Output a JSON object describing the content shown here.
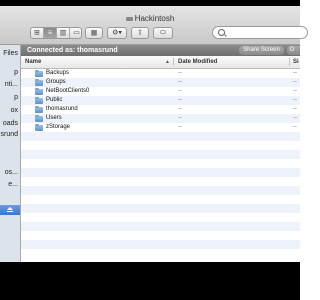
{
  "window": {
    "title": "Hackintosh"
  },
  "toolbar": {
    "view_buttons": [
      "icon-view",
      "list-view",
      "column-view",
      "coverflow-view"
    ],
    "selected_view": "list-view",
    "search": {
      "placeholder": "",
      "value": ""
    }
  },
  "sidebar": {
    "items": [
      {
        "label": "Files"
      },
      {
        "label": "p"
      },
      {
        "label": "nti..."
      },
      {
        "label": "p"
      },
      {
        "label": "ox"
      },
      {
        "label": "oads"
      },
      {
        "label": "srund"
      },
      {
        "label": "os..."
      },
      {
        "label": "e..."
      }
    ]
  },
  "connection": {
    "status": "Connected as: thomasrund",
    "share_screen_label": "Share Screen",
    "connect_label": "D"
  },
  "columns": {
    "name": "Name",
    "date_modified": "Date Modified",
    "size": "Si"
  },
  "files": [
    {
      "name": "Backups",
      "date": "--",
      "size": "--"
    },
    {
      "name": "Groups",
      "date": "--",
      "size": "--"
    },
    {
      "name": "NetBootClients0",
      "date": "--",
      "size": "--"
    },
    {
      "name": "Public",
      "date": "--",
      "size": "--"
    },
    {
      "name": "thomasrund",
      "date": "--",
      "size": "--"
    },
    {
      "name": "Users",
      "date": "--",
      "size": "--"
    },
    {
      "name": "zStorage",
      "date": "--",
      "size": "--"
    }
  ],
  "colors": {
    "selection": "#3d76c9",
    "folder": "#5f8fc7",
    "connect_bar": "#7d7d7d"
  }
}
